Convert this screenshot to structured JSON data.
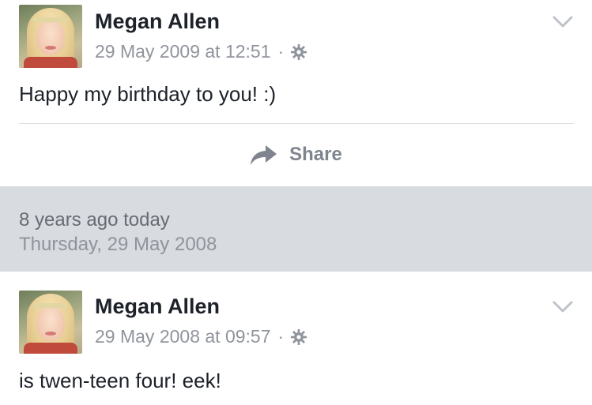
{
  "posts": [
    {
      "author": "Megan Allen",
      "timestamp": "29 May 2009 at 12:51",
      "separator": "·",
      "audience_icon": "gear-icon",
      "text": "Happy my birthday to you! :)",
      "share_label": "Share"
    },
    {
      "author": "Megan Allen",
      "timestamp": "29 May 2008 at 09:57",
      "separator": "·",
      "audience_icon": "gear-icon",
      "text": "is twen-teen four! eek!"
    }
  ],
  "memory": {
    "title": "8 years ago today",
    "date": "Thursday, 29 May 2008"
  },
  "colors": {
    "memory_background": "#d8dbe0",
    "meta_text": "#90949c",
    "name_text": "#1d2129"
  }
}
